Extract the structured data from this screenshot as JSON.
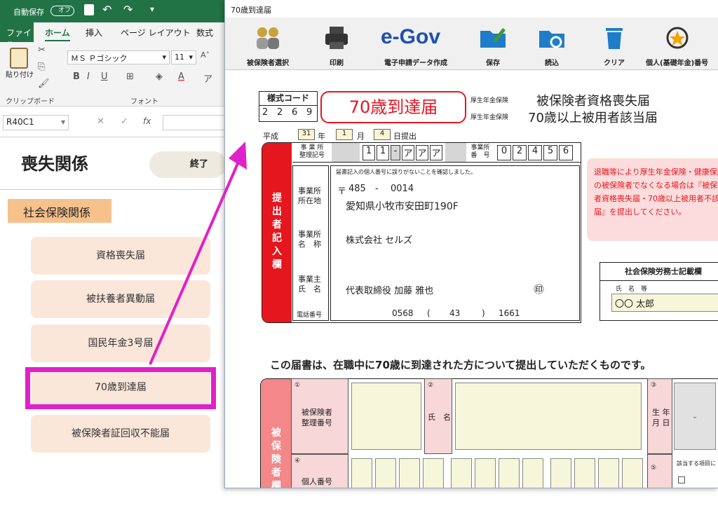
{
  "excel": {
    "qat": {
      "autosave_label": "自動保存",
      "autosave_state": "オフ"
    },
    "tabs": [
      "ファイル",
      "ホーム",
      "挿入",
      "ページ レイアウト",
      "数式"
    ],
    "font_name": "ＭＳ Ｐゴシック",
    "font_size": "11",
    "paste_label": "貼り付け",
    "group_clipboard": "クリップボード",
    "group_font": "フォント",
    "bold": "B",
    "italic": "I",
    "underline": "U",
    "name_box": "R40C1",
    "fx": "fx",
    "sheet": {
      "title": "喪失関係",
      "end_button": "終了",
      "section": "社会保険関係",
      "buttons": [
        "資格喪失届",
        "被扶養者異動届",
        "国民年金3号届",
        "70歳到達届",
        "被保険者証回収不能届"
      ]
    }
  },
  "dialog": {
    "title": "70歳到達届",
    "toolbar": [
      "被保険者選択",
      "印刷",
      "電子申請データ作成",
      "保存",
      "読込",
      "クリア",
      "個人(基礎年金)番号"
    ],
    "egov": "e-Gov",
    "form": {
      "style_code_label": "様式コード",
      "style_code": [
        "2",
        "2",
        "6",
        "9"
      ],
      "form_title": "70歳到達届",
      "pension_labels": [
        "厚生年金保険",
        "厚生年金保険"
      ],
      "heading1": "被保険者資格喪失届",
      "heading2": "70歳以上被用者該当届",
      "era": "平成",
      "year": "31",
      "year_unit": "年",
      "month": "1",
      "month_unit": "月",
      "day": "4",
      "day_unit": "日提出",
      "office_code_label": "事 業 所\n整理記号",
      "office_code": [
        "1",
        "1",
        "-",
        "ア",
        "ア",
        "ア"
      ],
      "office_no_label": "事業所\n番　号",
      "office_no": [
        "0",
        "2",
        "4",
        "5",
        "6"
      ],
      "submitter_side": "提\n出\n者\n記\n入\n欄",
      "confirm_note": "届書記入の個人番号に誤りがないことを確認しました。",
      "addr_label": "事業所\n所在地",
      "postal_mark": "〒",
      "postal1": "485",
      "postal_dash": "-",
      "postal2": "0014",
      "address": "愛知県小牧市安田町190F",
      "name_label": "事業所\n名　称",
      "company": "株式会社  セルズ",
      "owner_label": "事業主\n氏　名",
      "owner": "代表取締役  加藤  雅也",
      "seal": "㊞",
      "tel_label": "電話番号",
      "tel1": "0568",
      "tel_open": "(",
      "tel2": "43",
      "tel_close": ")",
      "tel3": "1661",
      "notice": "退職等により厚生年金保険・健康保険の被保険者でなくなる場合は『被保険者資格喪失届・70歳以上被用者不該当届』を提出してください。",
      "sharoushi_title": "社会保険労務士記載欄",
      "sharoushi_name_label": "氏　名　等",
      "sharoushi_name": "〇〇  太郎",
      "statement": "この届書は、在職中に70歳に到達された方について提出していただくものです。",
      "insured_side": "被\n保\n険\n者\n欄",
      "c1_num": "①",
      "c1_label": "被保険者\n整理番号",
      "c2_num": "②",
      "c2_label": "氏　名",
      "c3_num": "③",
      "c3_label": "生 年\n月 日",
      "c4_num": "④",
      "c4_label": "個人番号",
      "c5_num": "⑤",
      "c5_label": "該当する項目に"
    }
  },
  "colors": {
    "excel_green": "#217346",
    "accent_magenta": "#e020c8",
    "form_red": "#e6161f",
    "pink": "#f3878a"
  }
}
